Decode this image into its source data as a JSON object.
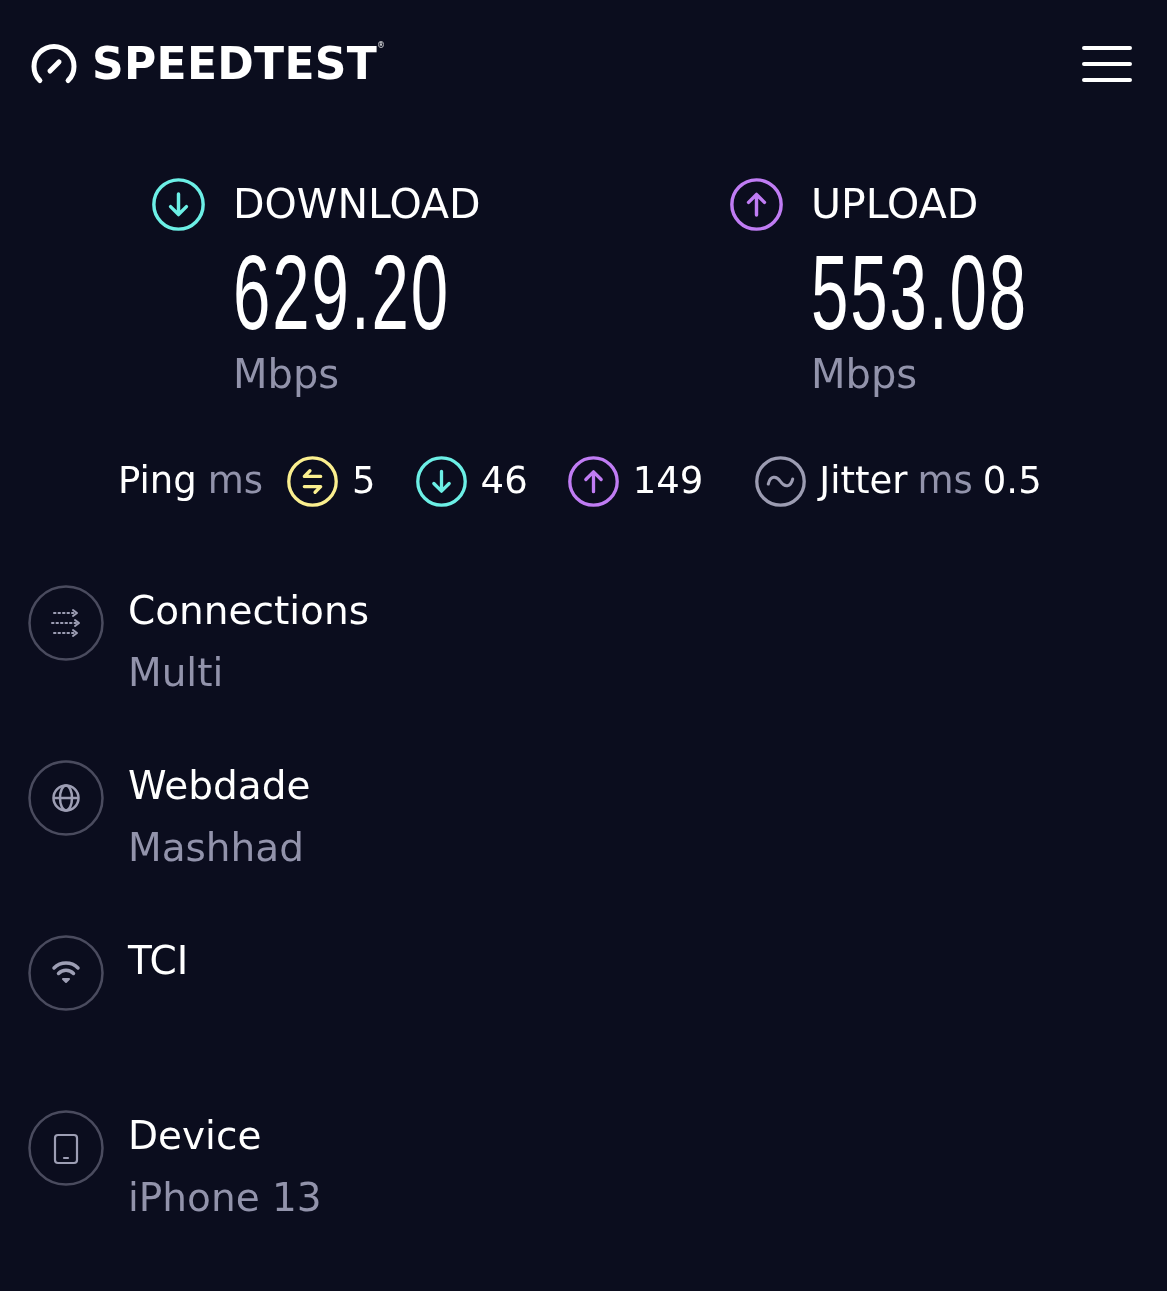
{
  "header": {
    "logo": "SPEEDTEST$^{®}$"
  },
  "results": [
    {
      "kind": "download",
      "label": "DOWNLOAD",
      "value": "629.20",
      "unit": "Mbps"
    },
    {
      "kind": "upload",
      "label": "UPLOAD",
      "value": "553.08",
      "unit": "Mbps"
    }
  ],
  "ping": {
    "label": "Ping",
    "unit": "ms",
    "readings": [
      {
        "kind": "idle",
        "value": "5"
      },
      {
        "kind": "download",
        "value": "46"
      },
      {
        "kind": "upload",
        "value": "149"
      }
    ]
  },
  "jitter": {
    "label": "Jitter",
    "unit": "ms",
    "value": "0.5"
  },
  "details": [
    {
      "kind": "connections",
      "title": "Connections",
      "value": "Multi"
    },
    {
      "kind": "server",
      "title": "Webdade",
      "value": "Mashhad"
    },
    {
      "kind": "provider",
      "title": "TCI"
    },
    {
      "kind": "device",
      "title": "Device",
      "value": "iPhone 13"
    }
  ]
}
